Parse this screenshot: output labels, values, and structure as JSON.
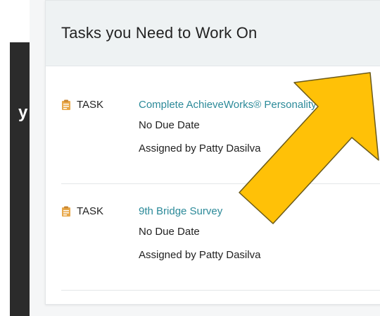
{
  "panel": {
    "title": "Tasks you Need to Work On"
  },
  "background": {
    "fragment_text": "y"
  },
  "tasks": [
    {
      "type_label": "TASK",
      "icon": "clipboard-icon",
      "title": "Complete AchieveWorks® Personality",
      "due": "No Due Date",
      "assigned": "Assigned by Patty Dasilva"
    },
    {
      "type_label": "TASK",
      "icon": "clipboard-icon",
      "title": "9th Bridge Survey",
      "due": "No Due Date",
      "assigned": "Assigned by Patty Dasilva"
    }
  ],
  "colors": {
    "link": "#2c8a99",
    "arrow_fill": "#ffc107",
    "arrow_stroke": "#6b5a1a",
    "icon": "#e8a84a"
  }
}
